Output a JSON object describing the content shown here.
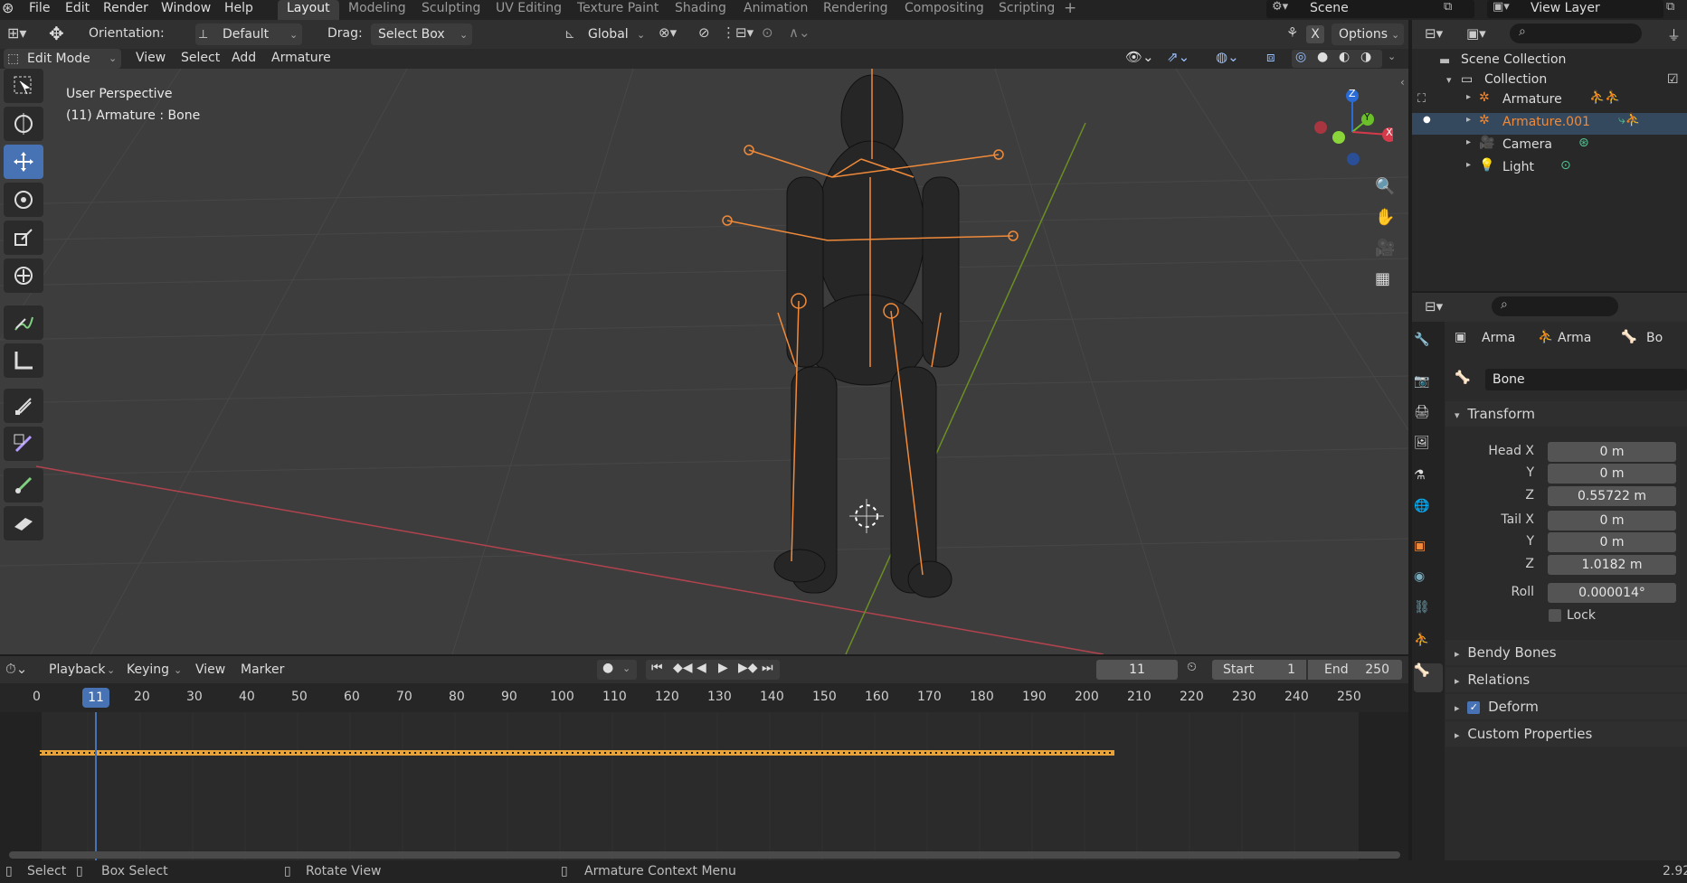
{
  "topbar": {
    "menus": [
      "File",
      "Edit",
      "Render",
      "Window",
      "Help"
    ],
    "workspaces": [
      "Layout",
      "Modeling",
      "Sculpting",
      "UV Editing",
      "Texture Paint",
      "Shading",
      "Animation",
      "Rendering",
      "Compositing",
      "Scripting"
    ],
    "active_workspace": "Layout",
    "add_label": "+",
    "scene": "Scene",
    "view_layer": "View Layer"
  },
  "toolheader": {
    "orientation_label": "Orientation:",
    "orientation_value": "Default",
    "drag_label": "Drag:",
    "drag_value": "Select Box",
    "transform_orientation": "Global",
    "options": "Options",
    "x_label": "X"
  },
  "viewheader": {
    "mode": "Edit Mode",
    "menus": [
      "View",
      "Select",
      "Add",
      "Armature"
    ]
  },
  "viewport": {
    "perspective": "User Perspective",
    "object_info": "(11) Armature : Bone",
    "gizmo_axes": {
      "z": "Z",
      "y": "Y",
      "x": "X"
    }
  },
  "outliner": {
    "scene_collection": "Scene Collection",
    "collection": "Collection",
    "items": [
      {
        "name": "Armature",
        "color": "#dcdcdc"
      },
      {
        "name": "Armature.001",
        "color": "#f08a3a"
      },
      {
        "name": "Camera",
        "color": "#dcdcdc"
      },
      {
        "name": "Light",
        "color": "#dcdcdc"
      }
    ]
  },
  "properties": {
    "breadcrumb": [
      "Arma",
      "Arma",
      "Bo"
    ],
    "bone_name": "Bone",
    "transform_title": "Transform",
    "fields": {
      "head_x_label": "Head X",
      "head_x": "0 m",
      "head_y_label": "Y",
      "head_y": "0 m",
      "head_z_label": "Z",
      "head_z": "0.55722 m",
      "tail_x_label": "Tail X",
      "tail_x": "0 m",
      "tail_y_label": "Y",
      "tail_y": "0 m",
      "tail_z_label": "Z",
      "tail_z": "1.0182 m",
      "roll_label": "Roll",
      "roll": "0.000014°"
    },
    "lock_label": "Lock",
    "panels": [
      "Bendy Bones",
      "Relations",
      "Deform",
      "Custom Properties"
    ]
  },
  "timeline": {
    "menus": [
      "Playback",
      "Keying",
      "View",
      "Marker"
    ],
    "current_frame": "11",
    "start_label": "Start",
    "start": "1",
    "end_label": "End",
    "end": "250",
    "ticks": [
      "0",
      "11",
      "20",
      "30",
      "40",
      "50",
      "60",
      "70",
      "80",
      "90",
      "100",
      "110",
      "120",
      "130",
      "140",
      "150",
      "160",
      "170",
      "180",
      "190",
      "200",
      "210",
      "220",
      "230",
      "240",
      "250"
    ]
  },
  "statusbar": {
    "select": "Select",
    "box_select": "Box Select",
    "rotate_view": "Rotate View",
    "context_menu": "Armature Context Menu",
    "version": "2.92"
  },
  "colors": {
    "accent": "#4772b3",
    "selection": "#f08a3a",
    "frame_marker": "#4772b3",
    "keyframe": "#e8a23a"
  }
}
